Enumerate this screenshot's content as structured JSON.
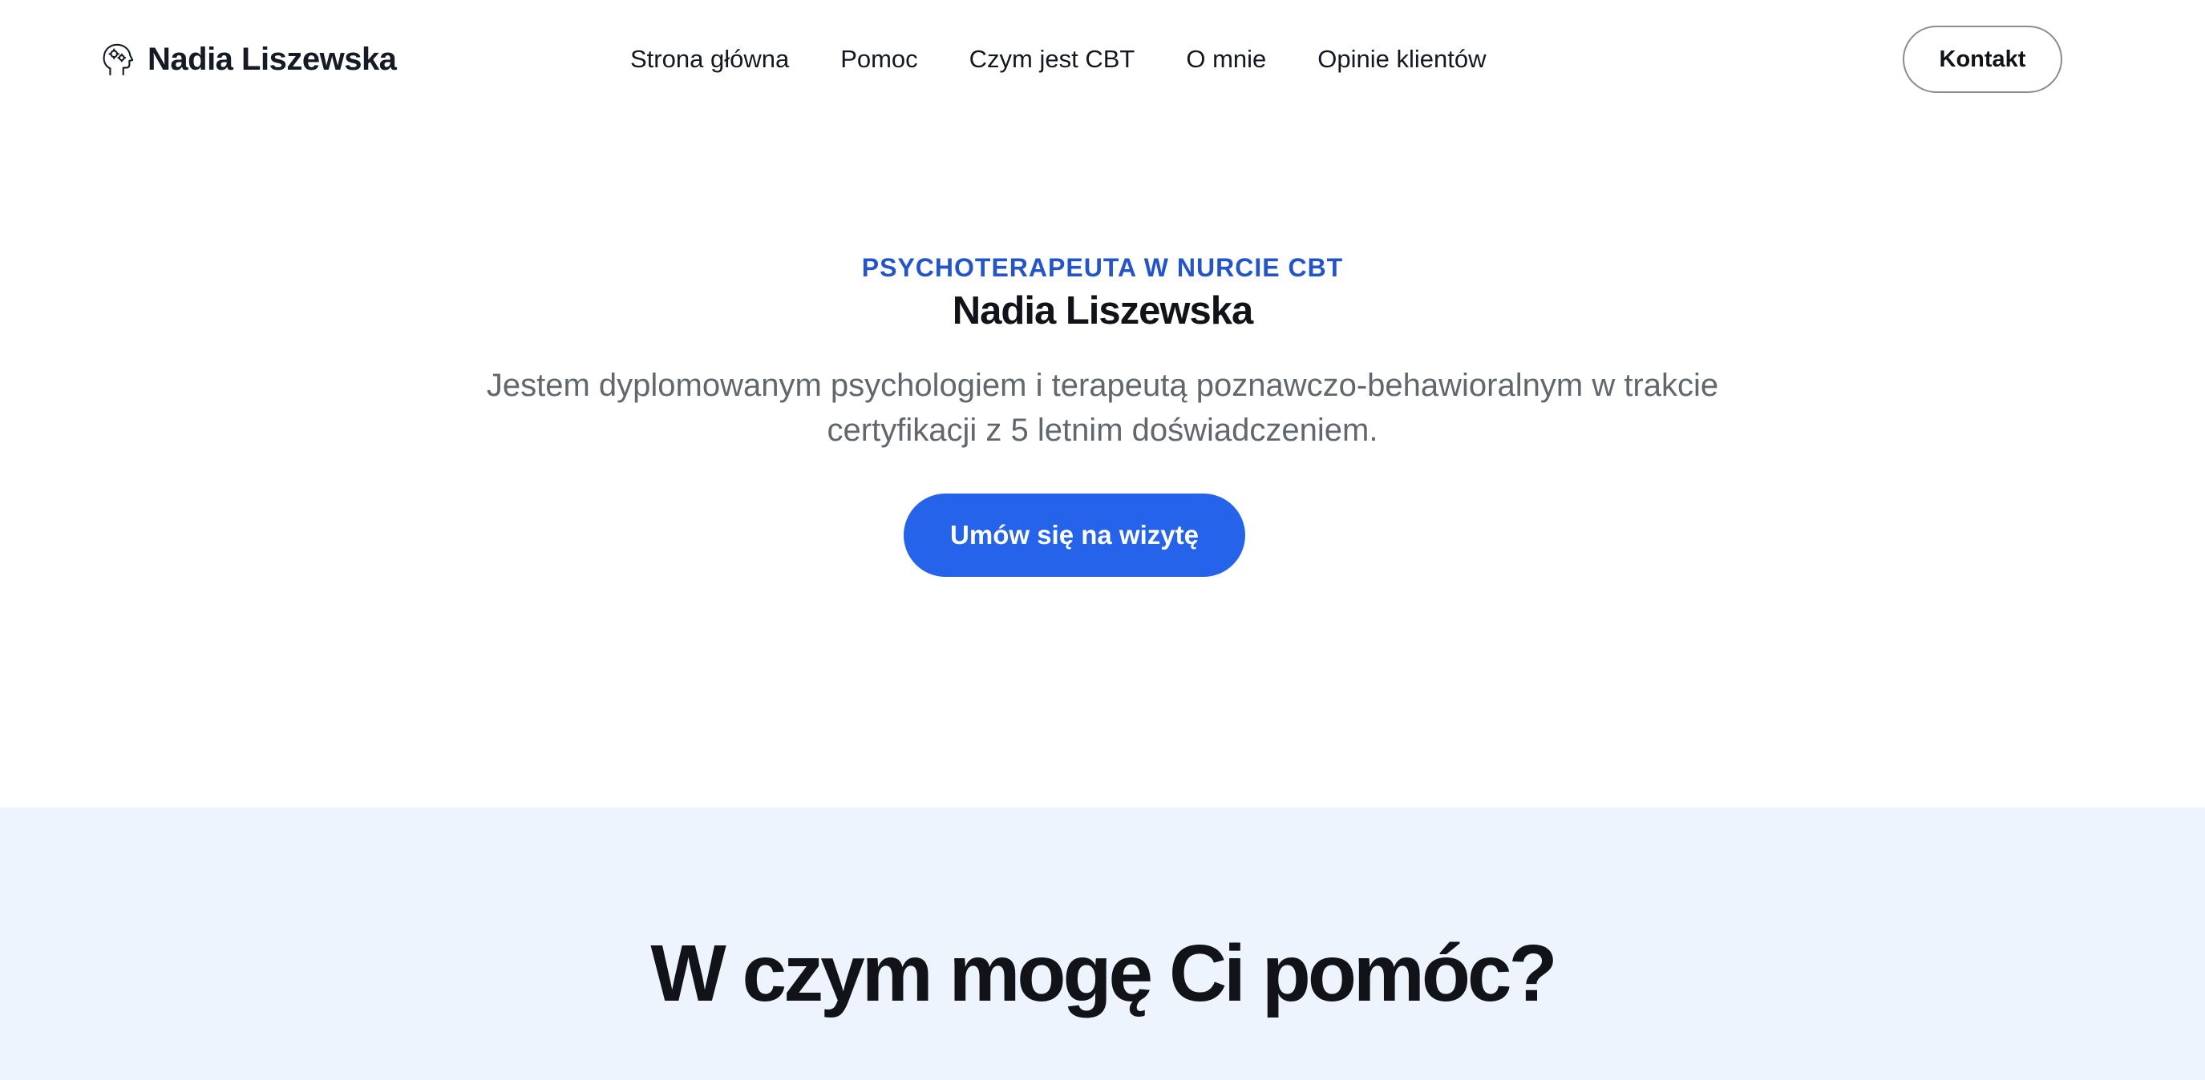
{
  "header": {
    "brand_name": "Nadia Liszewska",
    "brand_icon": "head-brain-gears-icon",
    "nav": [
      {
        "label": "Strona główna"
      },
      {
        "label": "Pomoc"
      },
      {
        "label": "Czym jest CBT"
      },
      {
        "label": "O mnie"
      },
      {
        "label": "Opinie klientów"
      }
    ],
    "contact_label": "Kontakt"
  },
  "hero": {
    "eyebrow": "PSYCHOTERAPEUTA W NURCIE CBT",
    "title": "Nadia Liszewska",
    "description": "Jestem dyplomowanym psychologiem i terapeutą poznawczo-behawioralnym w trakcie certyfikacji z 5 letnim doświadczeniem.",
    "cta_label": "Umów się na wizytę"
  },
  "help_section": {
    "title": "W czym mogę Ci pomóc?"
  },
  "colors": {
    "accent": "#2563eb",
    "eyebrow": "#2354c8",
    "section_bg": "#eef4fd",
    "text_dark": "#111318",
    "text_muted": "#62666d"
  }
}
